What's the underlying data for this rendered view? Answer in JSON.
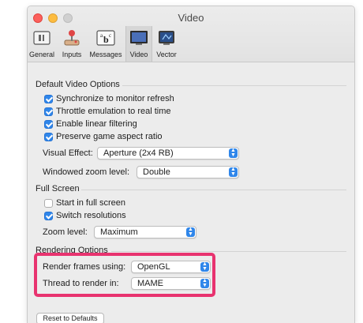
{
  "window": {
    "title": "Video"
  },
  "toolbar": {
    "items": [
      {
        "label": "General",
        "icon": "general-icon"
      },
      {
        "label": "Inputs",
        "icon": "joystick-icon"
      },
      {
        "label": "Messages",
        "icon": "messages-icon"
      },
      {
        "label": "Video",
        "icon": "monitor-icon",
        "selected": true
      },
      {
        "label": "Vector",
        "icon": "vector-icon"
      }
    ]
  },
  "default_video": {
    "title": "Default Video Options",
    "options": [
      {
        "label": "Synchronize to monitor refresh",
        "checked": true
      },
      {
        "label": "Throttle emulation to real time",
        "checked": true
      },
      {
        "label": "Enable linear filtering",
        "checked": true
      },
      {
        "label": "Preserve game aspect ratio",
        "checked": true
      }
    ],
    "visual_effect": {
      "label": "Visual Effect:",
      "value": "Aperture (2x4 RB)"
    },
    "windowed_zoom": {
      "label": "Windowed zoom level:",
      "value": "Double"
    }
  },
  "full_screen": {
    "title": "Full Screen",
    "options": [
      {
        "label": "Start in full screen",
        "checked": false
      },
      {
        "label": "Switch resolutions",
        "checked": true
      }
    ],
    "zoom_level": {
      "label": "Zoom level:",
      "value": "Maximum"
    }
  },
  "rendering": {
    "title": "Rendering Options",
    "render_frames": {
      "label": "Render frames using:",
      "value": "OpenGL"
    },
    "thread": {
      "label": "Thread to render in:",
      "value": "MAME"
    }
  },
  "reset_button": "Reset to Defaults",
  "colors": {
    "accent": "#2f86ea",
    "highlight": "#e8336f"
  }
}
